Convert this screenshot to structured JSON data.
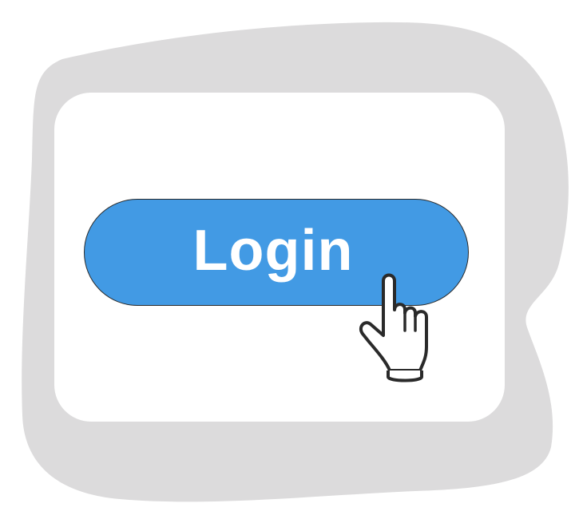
{
  "login_button": {
    "label": "Login"
  },
  "cursor": {
    "icon": "hand-pointer-icon"
  },
  "colors": {
    "background_blob": "#dcdbdc",
    "panel": "#ffffff",
    "button_fill": "#429ae4",
    "button_text": "#ffffff",
    "outline": "#2a2a2a"
  }
}
